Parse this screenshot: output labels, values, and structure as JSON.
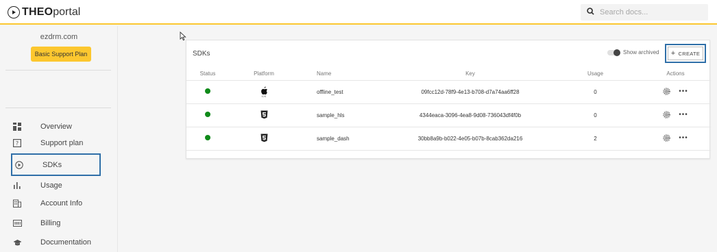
{
  "header": {
    "logo_strong": "THEO",
    "logo_light": "portal",
    "search_placeholder": "Search docs..."
  },
  "sidebar": {
    "org_name": "ezdrm.com",
    "plan_label": "Basic Support Plan",
    "items": [
      {
        "label": "Overview",
        "icon": "grid-icon"
      },
      {
        "label": "Support plan",
        "icon": "question-icon"
      },
      {
        "label": "SDKs",
        "icon": "play-circle-icon"
      },
      {
        "label": "Usage",
        "icon": "bar-chart-icon"
      },
      {
        "label": "Account Info",
        "icon": "building-icon"
      },
      {
        "label": "Billing",
        "icon": "invoice-icon"
      },
      {
        "label": "Documentation",
        "icon": "graduation-cap-icon"
      }
    ],
    "active_item": "SDKs"
  },
  "sdks": {
    "title": "SDKs",
    "show_archived_label": "Show archived",
    "create_label": "CREATE",
    "columns": [
      "Status",
      "Platform",
      "Name",
      "Key",
      "Usage",
      "Actions"
    ],
    "rows": [
      {
        "status": "active",
        "platform": "ios",
        "platform_label": "iOS",
        "name": "offline_test",
        "key": "09fcc12d-78f9-4e13-b708-d7a74aa6ff28",
        "usage": "0"
      },
      {
        "status": "active",
        "platform": "html5",
        "name": "sample_hls",
        "key": "4344eaca-3096-4ea8-9d08-736043df4f0b",
        "usage": "0"
      },
      {
        "status": "active",
        "platform": "html5",
        "name": "sample_dash",
        "key": "30bb8a9b-b022-4e05-b07b-8cab362da216",
        "usage": "2"
      }
    ]
  },
  "colors": {
    "accent": "#fcc72f",
    "highlight_border": "#2f6fa8",
    "status_active": "#0f8a19"
  }
}
